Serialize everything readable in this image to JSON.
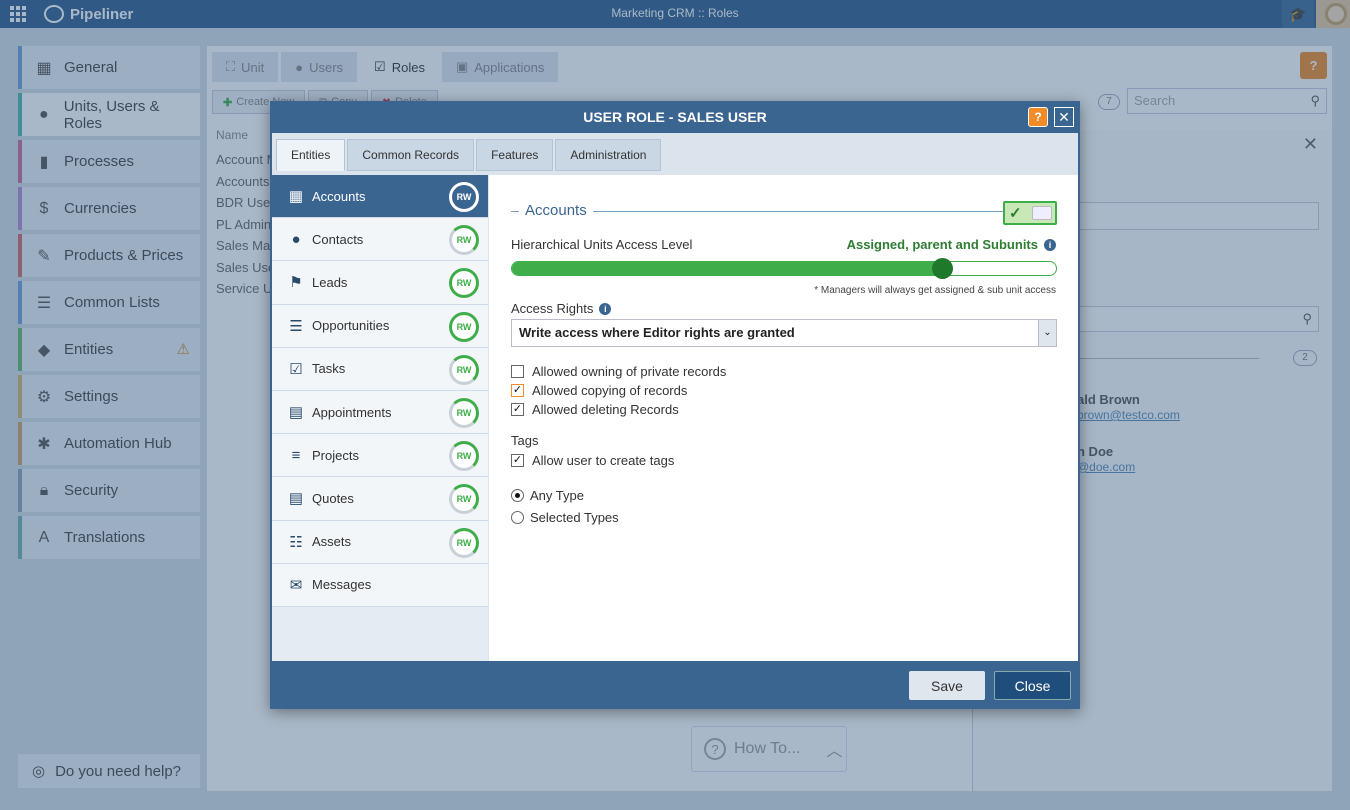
{
  "app": {
    "logo": "Pipeliner",
    "title": "Marketing CRM :: Roles"
  },
  "sidebar": {
    "items": [
      {
        "label": "General",
        "icon": "building-icon",
        "color": "#6aa0d8"
      },
      {
        "label": "Units, Users & Roles",
        "icon": "user-icon",
        "color": "#4cb4a7"
      },
      {
        "label": "Processes",
        "icon": "processes-icon",
        "color": "#c96a9a"
      },
      {
        "label": "Currencies",
        "icon": "dollar-icon",
        "color": "#b38ad0"
      },
      {
        "label": "Products & Prices",
        "icon": "tag-icon",
        "color": "#d16a6a"
      },
      {
        "label": "Common Lists",
        "icon": "list-edit-icon",
        "color": "#6aa0d8"
      },
      {
        "label": "Entities",
        "icon": "entities-icon",
        "color": "#5fb86a"
      },
      {
        "label": "Settings",
        "icon": "gear-icon",
        "color": "#d1b66a"
      },
      {
        "label": "Automation Hub",
        "icon": "hub-icon",
        "color": "#c9a36a"
      },
      {
        "label": "Security",
        "icon": "lock-icon",
        "color": "#8aa0b8"
      },
      {
        "label": "Translations",
        "icon": "translate-icon",
        "color": "#6ab0b0"
      }
    ],
    "help": "Do you need help?"
  },
  "background": {
    "tabs": [
      "Unit",
      "Users",
      "Roles",
      "Applications"
    ],
    "toolbar": [
      "Create New",
      "Copy",
      "Delete"
    ],
    "count": "7",
    "search_placeholder": "Search",
    "name_header": "Name",
    "roles": [
      "Account M",
      "Accounts",
      "BDR User",
      "PL Admin",
      "Sales Mar",
      "Sales Use",
      "Service U"
    ],
    "users_count": "2",
    "users": [
      {
        "name": "ald Brown",
        "email": "brown@testco.com"
      },
      {
        "name": "n Doe",
        "email": "@doe.com"
      }
    ],
    "howto": "How To..."
  },
  "dialog": {
    "title": "USER ROLE - SALES USER",
    "tabs": [
      "Entities",
      "Common Records",
      "Features",
      "Administration"
    ],
    "entities": [
      {
        "label": "Accounts",
        "badge": "RW",
        "icon": "building-icon",
        "full": true
      },
      {
        "label": "Contacts",
        "badge": "RW",
        "icon": "contact-icon",
        "full": false
      },
      {
        "label": "Leads",
        "badge": "RW",
        "icon": "lead-icon",
        "full": true
      },
      {
        "label": "Opportunities",
        "badge": "RW",
        "icon": "opportunity-icon",
        "full": true
      },
      {
        "label": "Tasks",
        "badge": "RW",
        "icon": "task-icon",
        "full": false
      },
      {
        "label": "Appointments",
        "badge": "RW",
        "icon": "calendar-icon",
        "full": false
      },
      {
        "label": "Projects",
        "badge": "RW",
        "icon": "project-icon",
        "full": false
      },
      {
        "label": "Quotes",
        "badge": "RW",
        "icon": "quote-icon",
        "full": false
      },
      {
        "label": "Assets",
        "badge": "RW",
        "icon": "assets-icon",
        "full": false
      },
      {
        "label": "Messages",
        "badge": "",
        "icon": "envelope-icon",
        "full": false
      }
    ],
    "section_title": "Accounts",
    "hierarchy_label": "Hierarchical Units Access Level",
    "hierarchy_value": "Assigned, parent and Subunits",
    "slider_fraction": 0.79,
    "managers_note": "* Managers will always get assigned & sub unit access",
    "access_rights_label": "Access Rights",
    "access_rights_value": "Write access where Editor rights are granted",
    "checkboxes": [
      {
        "label": "Allowed owning of private records",
        "checked": false
      },
      {
        "label": "Allowed copying of records",
        "checked": true
      },
      {
        "label": "Allowed deleting Records",
        "checked": true
      }
    ],
    "tags_label": "Tags",
    "tags_checkbox": {
      "label": "Allow user to create tags",
      "checked": true
    },
    "radios": [
      {
        "label": "Any Type",
        "selected": true
      },
      {
        "label": "Selected Types",
        "selected": false
      }
    ],
    "save_label": "Save",
    "close_label": "Close"
  }
}
